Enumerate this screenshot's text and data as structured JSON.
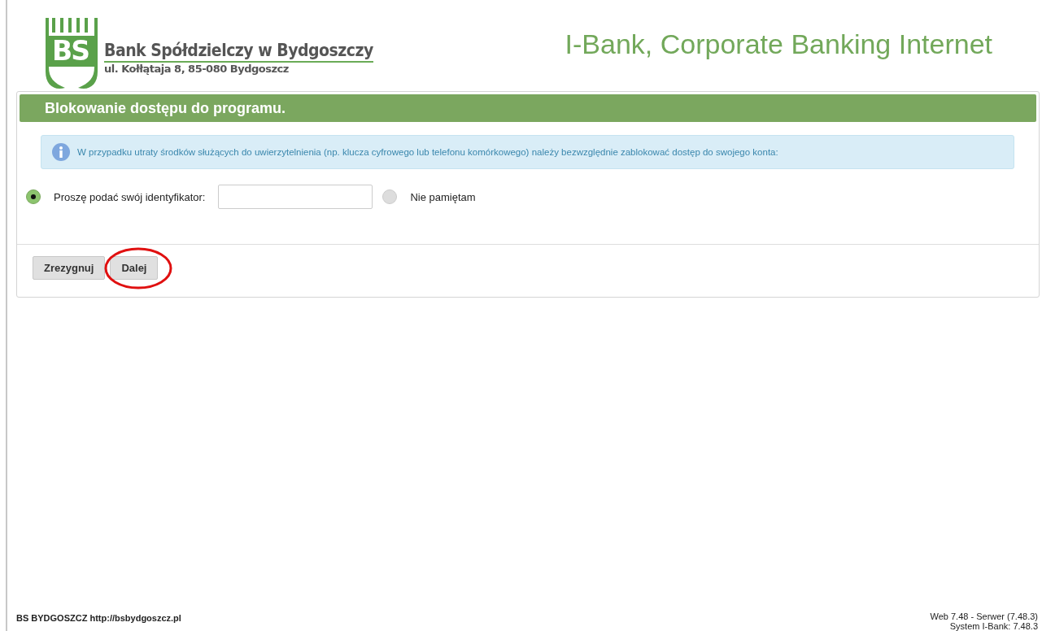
{
  "header": {
    "bank_name": "Bank Spółdzielczy w Bydgoszczy",
    "bank_address": "ul. Kołłątaja 8, 85-080 Bydgoszcz",
    "logo_letters": "BS",
    "app_title": "I-Bank, Corporate Banking Internet"
  },
  "panel": {
    "title": "Blokowanie dostępu do programu.",
    "info": "W przypadku utraty środków służących do uwierzytelnienia (np. klucza cyfrowego lub telefonu komórkowego) należy bezwzględnie zablokować dostęp do swojego konta:",
    "options": [
      {
        "kind": "field",
        "label": "Proszę podać swój identyfikator:",
        "selected": true
      },
      {
        "kind": "plain",
        "label": "Nie pamiętam",
        "selected": false
      }
    ],
    "buttons": [
      {
        "label": "Zrezygnuj",
        "highlighted": false
      },
      {
        "label": "Dalej",
        "highlighted": true
      }
    ]
  },
  "footer": {
    "left": "BS BYDGOSZCZ http://bsbydgoszcz.pl",
    "right": [
      "Web 7.48 - Serwer (7.48.3)",
      "System I-Bank: 7.48.3"
    ]
  }
}
